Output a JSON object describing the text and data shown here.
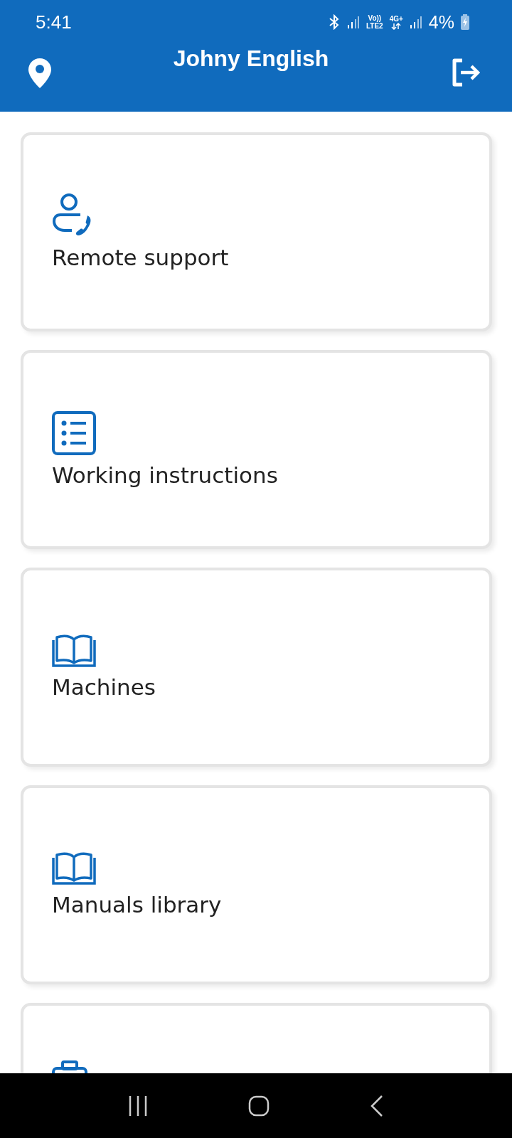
{
  "status_bar": {
    "time": "5:41",
    "volte": "Vo))",
    "lte": "LTE2",
    "network": "4G+",
    "battery": "4%"
  },
  "header": {
    "title": "Johny English"
  },
  "cards": [
    {
      "kind": "remote-support",
      "label": "Remote support"
    },
    {
      "kind": "instructions",
      "label": "Working instructions"
    },
    {
      "kind": "book",
      "label": "Machines"
    },
    {
      "kind": "book",
      "label": "Manuals library"
    },
    {
      "kind": "briefcase"
    }
  ]
}
